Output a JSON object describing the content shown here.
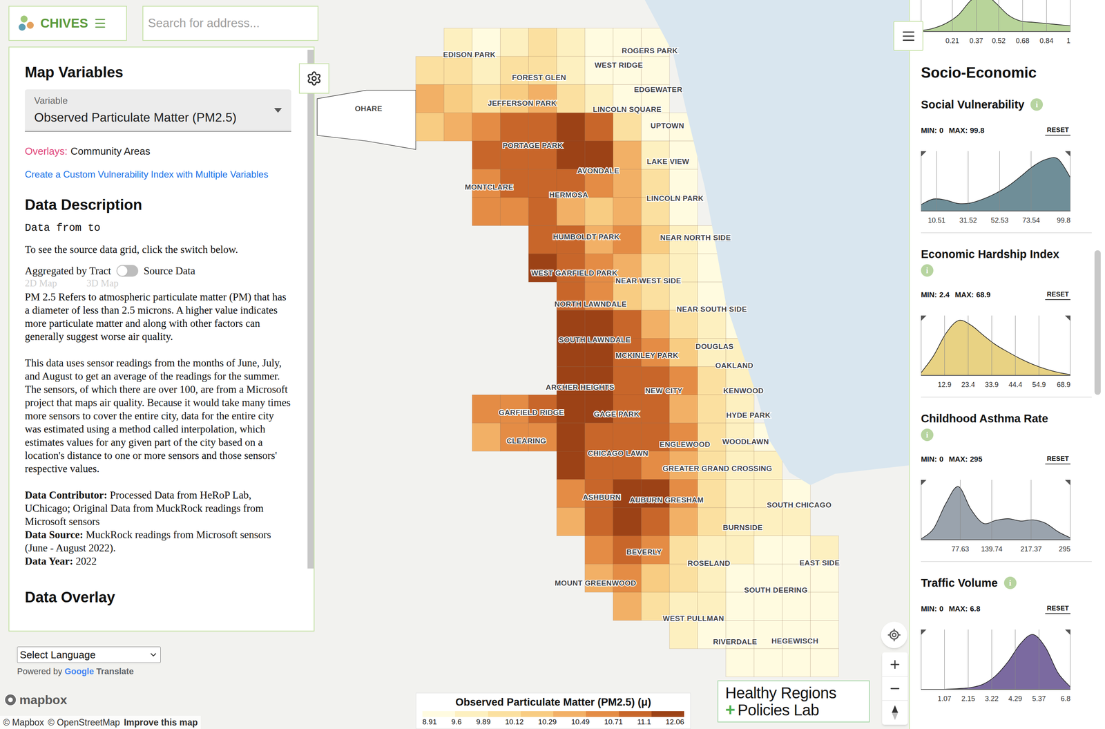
{
  "app": {
    "name": "CHIVES"
  },
  "search": {
    "placeholder": "Search for address..."
  },
  "left_panel": {
    "title": "Map Variables",
    "variable_select": {
      "label": "Variable",
      "value": "Observed Particulate Matter (PM2.5)"
    },
    "overlays": {
      "label": "Overlays:",
      "value": "Community Areas"
    },
    "custom_index_link": "Create a Custom Vulnerability Index with Multiple Variables",
    "description_title": "Data Description",
    "data_range": "Data from to",
    "switch_hint": "To see the source data grid, click the switch below.",
    "toggle": {
      "left_label": "Aggregated by Tract",
      "right_label": "Source Data",
      "on": false
    },
    "map_modes": [
      {
        "label": "2D Map",
        "disabled": true
      },
      {
        "label": "3D Map",
        "disabled": true
      }
    ],
    "paragraphs": [
      "PM 2.5 Refers to atmospheric particulate matter (PM) that has a diameter of less than 2.5 microns. A higher value indicates more particulate matter and along with other factors can generally suggest worse air quality.",
      "This data uses sensor readings from the months of June, July, and August to get an average of the readings for the summer. The sensors, of which there are over 100, are from a Microsoft project that maps air quality. Because it would take many times more sensors to cover the entire city, data for the entire city was estimated using a method called interpolation, which estimates values for any given part of the city based on a location's distance to one or more sensors and those sensors' respective values."
    ],
    "meta": [
      {
        "label": "Data Contributor:",
        "value": "Processed Data from HeRoP Lab, UChicago; Original Data from MuckRock readings from Microsoft sensors"
      },
      {
        "label": "Data Source:",
        "value": "MuckRock readings from Microsoft sensors (June - August 2022)."
      },
      {
        "label": "Data Year:",
        "value": "2022"
      }
    ],
    "next_section_title": "Data Overlay"
  },
  "language": {
    "select": "Select Language",
    "powered_by": "Powered by",
    "google": "Google",
    "translate": "Translate"
  },
  "attribution": {
    "logo": "mapbox",
    "items": [
      "© Mapbox",
      "© OpenStreetMap"
    ],
    "improve": "Improve this map"
  },
  "logo": {
    "line1": "Healthy Regions",
    "plus": "+",
    "line2": "Policies Lab"
  },
  "map": {
    "legend": {
      "title": "Observed Particulate Matter (PM2.5) (μ)",
      "breaks": [
        "8.91",
        "9.6",
        "9.89",
        "10.12",
        "10.29",
        "10.49",
        "10.71",
        "11.1",
        "12.06"
      ],
      "colors": [
        "#fffbe0",
        "#fdf0c0",
        "#fbe0a0",
        "#f8cc82",
        "#f2b066",
        "#e48c45",
        "#c8662a",
        "#9c4216"
      ]
    },
    "grid": [
      [
        null,
        9.7,
        9.5,
        9.8,
        9.9,
        9.6,
        9.4,
        9.2,
        9.1,
        null,
        null,
        null,
        null,
        null,
        null
      ],
      [
        10.0,
        9.9,
        9.7,
        10.0,
        10.1,
        9.8,
        9.5,
        9.3,
        9.2,
        null,
        null,
        null,
        null,
        null,
        null
      ],
      [
        10.3,
        10.2,
        10.1,
        10.2,
        10.3,
        10.0,
        9.7,
        9.4,
        9.3,
        null,
        null,
        null,
        null,
        null,
        null
      ],
      [
        10.2,
        10.4,
        10.6,
        10.8,
        11.0,
        11.2,
        10.8,
        10.0,
        9.5,
        9.3,
        null,
        null,
        null,
        null,
        null
      ],
      [
        null,
        null,
        10.8,
        10.9,
        11.0,
        11.3,
        11.2,
        10.4,
        9.8,
        9.3,
        null,
        null,
        null,
        null,
        null
      ],
      [
        null,
        null,
        10.6,
        10.8,
        10.9,
        11.0,
        10.6,
        10.3,
        10.0,
        9.4,
        null,
        null,
        null,
        null,
        null
      ],
      [
        null,
        null,
        10.5,
        10.7,
        10.8,
        10.4,
        10.2,
        10.4,
        10.1,
        9.5,
        null,
        null,
        null,
        null,
        null
      ],
      [
        null,
        null,
        null,
        null,
        10.9,
        10.8,
        10.4,
        10.6,
        10.2,
        9.8,
        9.4,
        null,
        null,
        null,
        null
      ],
      [
        null,
        null,
        null,
        null,
        11.2,
        10.9,
        10.6,
        10.3,
        9.9,
        9.6,
        9.3,
        null,
        null,
        null,
        null
      ],
      [
        null,
        null,
        null,
        null,
        null,
        11.0,
        10.5,
        10.2,
        10.0,
        9.8,
        9.4,
        null,
        null,
        null,
        null
      ],
      [
        null,
        null,
        null,
        null,
        null,
        11.3,
        11.2,
        10.8,
        10.3,
        10.0,
        9.6,
        9.5,
        null,
        null,
        null
      ],
      [
        null,
        null,
        null,
        null,
        null,
        11.4,
        11.5,
        11.0,
        10.6,
        10.2,
        9.8,
        9.6,
        null,
        null,
        null
      ],
      [
        null,
        null,
        null,
        null,
        null,
        11.3,
        11.2,
        11.0,
        10.8,
        10.6,
        10.0,
        9.7,
        null,
        null,
        null
      ],
      [
        null,
        null,
        10.6,
        10.7,
        10.8,
        11.4,
        11.2,
        10.9,
        11.0,
        10.4,
        9.9,
        9.6,
        null,
        null,
        null
      ],
      [
        null,
        null,
        10.3,
        10.5,
        10.7,
        11.3,
        11.0,
        10.8,
        10.9,
        10.5,
        10.0,
        9.7,
        9.5,
        null,
        null
      ],
      [
        null,
        null,
        null,
        null,
        null,
        11.1,
        10.9,
        10.8,
        10.7,
        10.4,
        10.1,
        9.8,
        9.6,
        null,
        null
      ],
      [
        null,
        null,
        null,
        null,
        null,
        10.7,
        10.9,
        11.2,
        11.1,
        10.5,
        10.0,
        9.7,
        9.6,
        9.5,
        null
      ],
      [
        null,
        null,
        null,
        null,
        null,
        10.4,
        10.8,
        11.1,
        10.9,
        10.3,
        9.9,
        9.6,
        9.8,
        9.7,
        null
      ],
      [
        null,
        null,
        null,
        null,
        null,
        null,
        10.6,
        10.9,
        10.5,
        10.0,
        9.8,
        9.6,
        9.4,
        9.5,
        9.6
      ],
      [
        null,
        null,
        null,
        null,
        null,
        null,
        10.3,
        10.5,
        10.2,
        9.9,
        9.7,
        9.5,
        9.3,
        9.4,
        9.5
      ],
      [
        null,
        null,
        null,
        null,
        null,
        null,
        null,
        10.4,
        10.1,
        9.8,
        9.6,
        9.4,
        9.3,
        9.3,
        9.4
      ],
      [
        null,
        null,
        null,
        null,
        null,
        null,
        null,
        null,
        null,
        9.7,
        9.5,
        9.4,
        9.3,
        9.2,
        9.3
      ],
      [
        null,
        null,
        null,
        null,
        null,
        null,
        null,
        null,
        null,
        null,
        null,
        9.3,
        9.2,
        9.2,
        9.3
      ]
    ],
    "labels": [
      "EDISON PARK",
      "ROGERS PARK",
      "WEST RIDGE",
      "FOREST GLEN",
      "EDGEWATER",
      "OHARE",
      "JEFFERSON PARK",
      "LINCOLN SQUARE",
      "UPTOWN",
      "PORTAGE PARK",
      "LAKE VIEW",
      "AVONDALE",
      "MONTCLARE",
      "HERMOSA",
      "LINCOLN PARK",
      "HUMBOLDT PARK",
      "NEAR NORTH SIDE",
      "WEST GARFIELD PARK",
      "NEAR WEST SIDE",
      "NORTH LAWNDALE",
      "NEAR SOUTH SIDE",
      "SOUTH LAWNDALE",
      "DOUGLAS",
      "MCKINLEY PARK",
      "OAKLAND",
      "ARCHER HEIGHTS",
      "NEW CITY",
      "KENWOOD",
      "GARFIELD RIDGE",
      "GAGE PARK",
      "HYDE PARK",
      "CLEARING",
      "ENGLEWOOD",
      "WOODLAWN",
      "CHICAGO LAWN",
      "GREATER GRAND CROSSING",
      "ASHBURN",
      "AUBURN GRESHAM",
      "SOUTH CHICAGO",
      "BURNSIDE",
      "BEVERLY",
      "ROSELAND",
      "EAST SIDE",
      "MOUNT GREENWOOD",
      "SOUTH DEERING",
      "WEST PULLMAN",
      "RIVERDALE",
      "HEGEWISCH"
    ]
  },
  "right_panel": {
    "top_chart": {
      "ticks": [
        "0.21",
        "0.37",
        "0.52",
        "0.68",
        "0.84",
        "1"
      ],
      "range": [
        0,
        1
      ],
      "color": "#b8d49a",
      "values": [
        0.05,
        0.15,
        0.35,
        0.7,
        1.3,
        1.6,
        1.2,
        0.7,
        0.45,
        0.4,
        0.35,
        0.3,
        0.25
      ]
    },
    "section_title": "Socio-Economic",
    "info_icon": "i",
    "min_label": "MIN:",
    "max_label": "MAX:",
    "reset": "RESET",
    "filters": [
      {
        "title": "Social Vulnerability",
        "min": "0",
        "max": "99.8",
        "ticks": [
          "10.51",
          "31.52",
          "52.53",
          "73.54",
          "99.8"
        ],
        "color": "#6f8e98",
        "values": [
          0.12,
          0.22,
          0.2,
          0.14,
          0.15,
          0.22,
          0.32,
          0.45,
          0.62,
          0.8,
          0.92,
          0.93,
          0.6
        ]
      },
      {
        "title": "Economic Hardship Index",
        "min": "2.4",
        "max": "68.9",
        "ticks": [
          "12.9",
          "23.4",
          "33.9",
          "44.4",
          "54.9",
          "68.9"
        ],
        "color": "#e8d283",
        "values": [
          0.05,
          0.35,
          0.75,
          0.98,
          0.9,
          0.72,
          0.55,
          0.42,
          0.3,
          0.2,
          0.12,
          0.06,
          0.02
        ]
      },
      {
        "title": "Childhood Asthma Rate",
        "min": "0",
        "max": "295",
        "ticks": [
          "77.63",
          "139.74",
          "217.37",
          "295"
        ],
        "color": "#9aa3ad",
        "values": [
          0.02,
          0.2,
          0.65,
          0.95,
          0.55,
          0.3,
          0.35,
          0.38,
          0.34,
          0.36,
          0.3,
          0.15,
          0.04
        ]
      },
      {
        "title": "Traffic Volume",
        "min": "0",
        "max": "6.8",
        "ticks": [
          "1.07",
          "2.15",
          "3.22",
          "4.29",
          "5.37",
          "6.8"
        ],
        "color": "#7b6aa0",
        "values": [
          0,
          0,
          0.01,
          0.02,
          0.04,
          0.1,
          0.25,
          0.5,
          0.82,
          0.98,
          0.75,
          0.3,
          0.05
        ]
      }
    ]
  }
}
